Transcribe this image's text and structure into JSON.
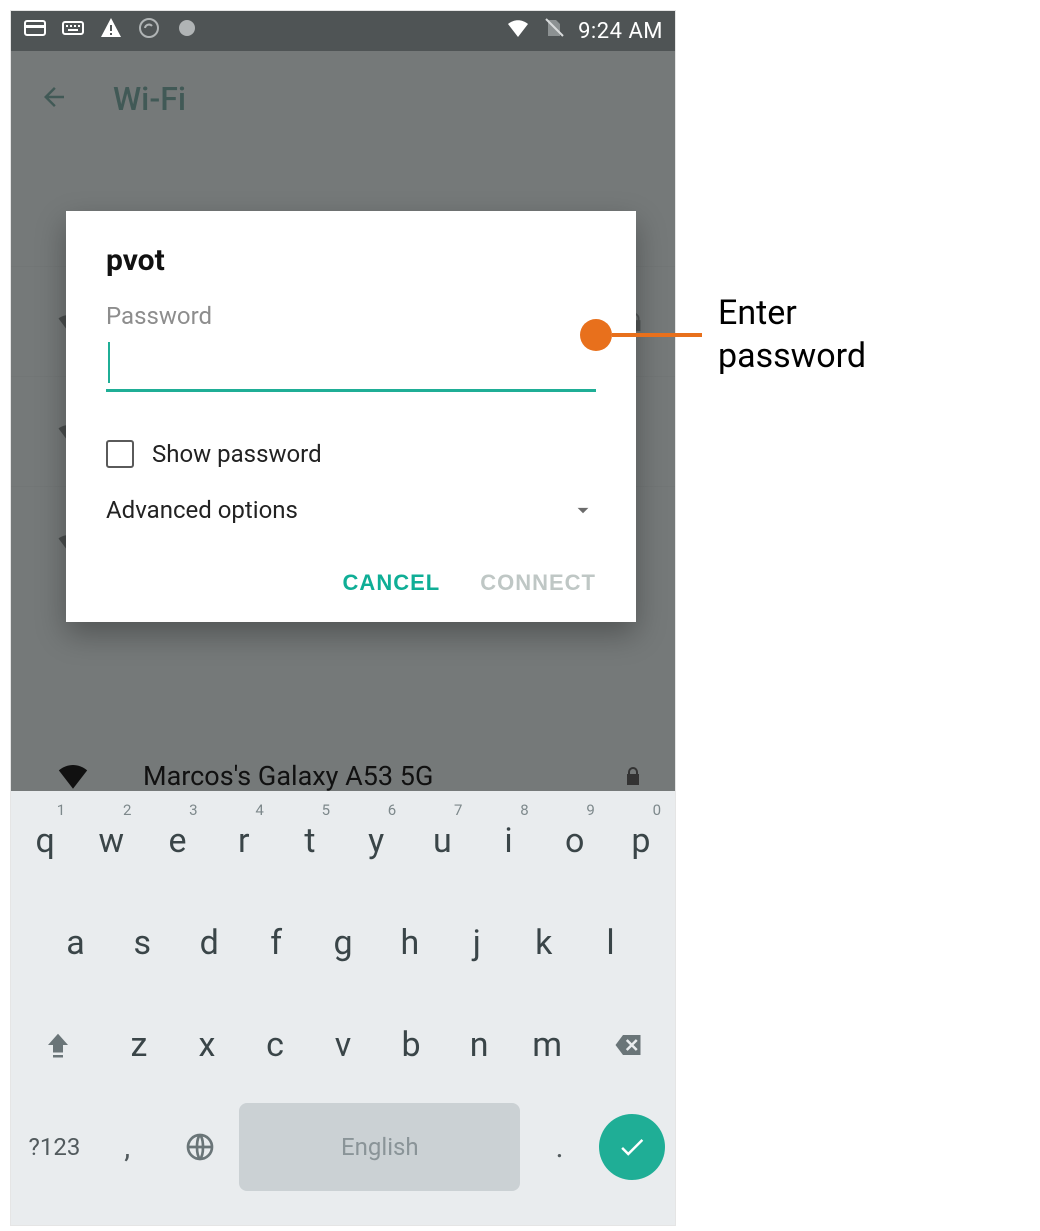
{
  "statusbar": {
    "time": "9:24 AM"
  },
  "appbar": {
    "title": "Wi-Fi"
  },
  "dialog": {
    "ssid": "pvot",
    "password_label": "Password",
    "password_value": "",
    "show_password_label": "Show password",
    "show_password_checked": false,
    "advanced_label": "Advanced options",
    "cancel_label": "CANCEL",
    "connect_label": "CONNECT"
  },
  "visible_network": {
    "name": "Marcos's Galaxy A53 5G"
  },
  "keyboard": {
    "row1": [
      {
        "k": "q",
        "n": "1"
      },
      {
        "k": "w",
        "n": "2"
      },
      {
        "k": "e",
        "n": "3"
      },
      {
        "k": "r",
        "n": "4"
      },
      {
        "k": "t",
        "n": "5"
      },
      {
        "k": "y",
        "n": "6"
      },
      {
        "k": "u",
        "n": "7"
      },
      {
        "k": "i",
        "n": "8"
      },
      {
        "k": "o",
        "n": "9"
      },
      {
        "k": "p",
        "n": "0"
      }
    ],
    "row2": [
      "a",
      "s",
      "d",
      "f",
      "g",
      "h",
      "j",
      "k",
      "l"
    ],
    "row3": [
      "z",
      "x",
      "c",
      "v",
      "b",
      "n",
      "m"
    ],
    "symkey": "?123",
    "comma": ",",
    "period": ".",
    "space_label": "English"
  },
  "callout": {
    "text_line1": "Enter",
    "text_line2": "password"
  }
}
